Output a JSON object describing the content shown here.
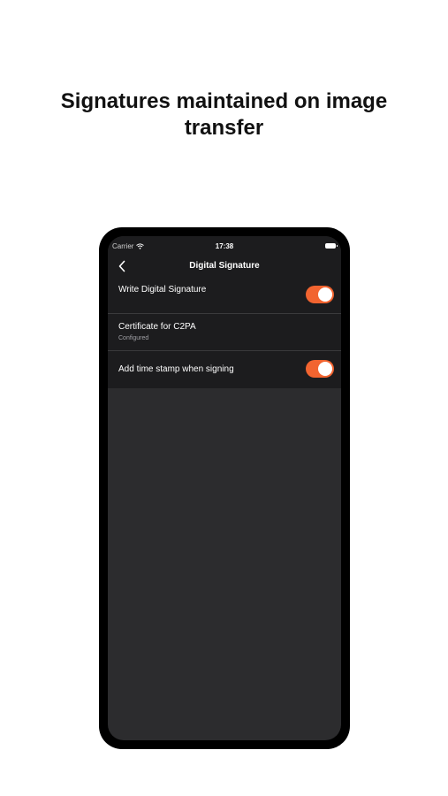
{
  "headline": {
    "line1": "Signatures maintained on image",
    "line2": "transfer"
  },
  "status_bar": {
    "carrier": "Carrier",
    "time": "17:38",
    "wifi_icon": "wifi-icon",
    "battery_icon": "battery-icon"
  },
  "nav": {
    "back_icon": "chevron-left-icon",
    "title": "Digital Signature"
  },
  "settings": [
    {
      "label": "Write Digital Signature",
      "toggle_on": true
    },
    {
      "label": "Certificate for C2PA",
      "sublabel": "Configured"
    },
    {
      "label": "Add time stamp when signing",
      "toggle_on": true
    }
  ],
  "colors": {
    "toggle_on": "#f26430",
    "screen_bg": "#2c2c2e",
    "cell_bg": "#1c1c1e"
  }
}
